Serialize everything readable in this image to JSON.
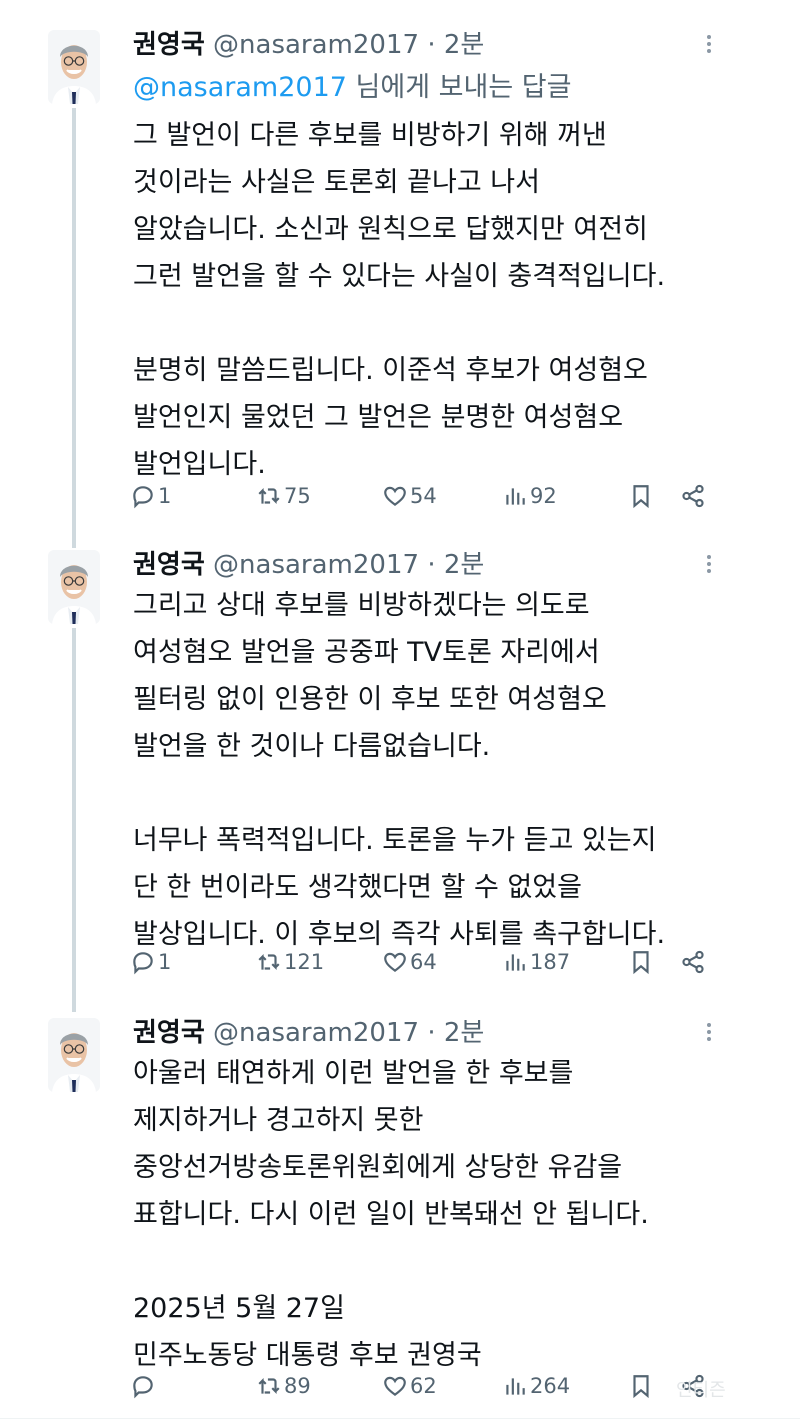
{
  "colors": {
    "text": "#0f1419",
    "secondary": "#536471",
    "accent": "#1d9bf0",
    "thread_line": "#cfd9de"
  },
  "tweets": [
    {
      "author_name": "권영국",
      "handle": "@nasaram2017",
      "separator": "·",
      "time": "2분",
      "reply_to": {
        "mention": "@nasaram2017",
        "suffix": "님에게 보내는 답글"
      },
      "lines": [
        "그 발언이 다른 후보를 비방하기 위해 꺼낸",
        "것이라는 사실은 토론회 끝나고 나서",
        "알았습니다. 소신과 원칙으로 답했지만 여전히",
        "그런 발언을 할 수 있다는 사실이 충격적입니다.",
        "",
        "분명히 말씀드립니다. 이준석 후보가 여성혐오",
        "발언인지 물었던 그 발언은 분명한 여성혐오",
        "발언입니다."
      ],
      "stats": {
        "replies": "1",
        "reposts": "75",
        "likes": "54",
        "views": "92"
      }
    },
    {
      "author_name": "권영국",
      "handle": "@nasaram2017",
      "separator": "·",
      "time": "2분",
      "lines": [
        "그리고 상대 후보를 비방하겠다는 의도로",
        "여성혐오 발언을 공중파 TV토론 자리에서",
        "필터링 없이 인용한 이 후보 또한 여성혐오",
        "발언을 한 것이나 다름없습니다.",
        "",
        "너무나 폭력적입니다. 토론을 누가 듣고 있는지",
        "단 한 번이라도 생각했다면 할 수 없었을",
        "발상입니다. 이 후보의 즉각 사퇴를 촉구합니다."
      ],
      "stats": {
        "replies": "1",
        "reposts": "121",
        "likes": "64",
        "views": "187"
      }
    },
    {
      "author_name": "권영국",
      "handle": "@nasaram2017",
      "separator": "·",
      "time": "2분",
      "lines": [
        "아울러 태연하게 이런 발언을 한 후보를",
        "제지하거나 경고하지 못한",
        "중앙선거방송토론위원회에게 상당한 유감을",
        "표합니다. 다시 이런 일이 반복돼선 안 됩니다.",
        "",
        "2025년 5월 27일",
        "민주노동당 대통령 후보 권영국"
      ],
      "stats": {
        "replies": "",
        "reposts": "89",
        "likes": "62",
        "views": "264"
      }
    }
  ],
  "watermark": "인티즌"
}
